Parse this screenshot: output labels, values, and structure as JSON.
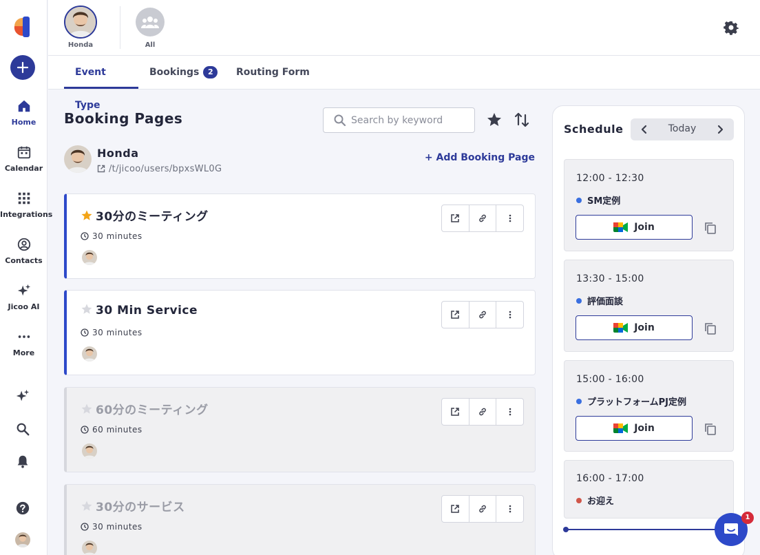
{
  "nav": {
    "items": [
      {
        "label": "Home",
        "icon": "home-icon"
      },
      {
        "label": "Calendar",
        "icon": "calendar-icon"
      },
      {
        "label": "Integrations",
        "icon": "apps-grid-icon"
      },
      {
        "label": "Contacts",
        "icon": "contact-icon"
      },
      {
        "label": "Jicoo AI",
        "icon": "sparkle-icon"
      },
      {
        "label": "More",
        "icon": "more-dots-icon"
      }
    ]
  },
  "accounts": [
    {
      "name": "Honda"
    },
    {
      "name": "All"
    }
  ],
  "tabs": [
    {
      "label": "Event Type"
    },
    {
      "label": "Bookings",
      "badge": "2"
    },
    {
      "label": "Routing Form"
    }
  ],
  "main": {
    "title": "Booking Pages",
    "search_placeholder": "Search by keyword",
    "user_name": "Honda",
    "user_path": "/t/jicoo/users/bpxsWL0G",
    "add_label": "+ Add Booking Page",
    "cards": [
      {
        "title": "30分のミーティング",
        "duration": "30 minutes",
        "starred": true,
        "disabled": false
      },
      {
        "title": "30 Min Service",
        "duration": "30 minutes",
        "starred": false,
        "disabled": false
      },
      {
        "title": "60分のミーティング",
        "duration": "60 minutes",
        "starred": false,
        "disabled": true
      },
      {
        "title": "30分のサービス",
        "duration": "30 minutes",
        "starred": false,
        "disabled": true
      }
    ]
  },
  "schedule": {
    "title": "Schedule",
    "today_label": "Today",
    "events": [
      {
        "time": "12:00 - 12:30",
        "name": "SM定例",
        "dot_color": "#3a6fe0",
        "join_label": "Join"
      },
      {
        "time": "13:30 - 15:00",
        "name": "評価面談",
        "dot_color": "#3a6fe0",
        "join_label": "Join"
      },
      {
        "time": "15:00 - 16:00",
        "name": "プラットフォームPJ定例",
        "dot_color": "#3a6fe0",
        "join_label": "Join"
      },
      {
        "time": "16:00 - 17:00",
        "name": "お迎え",
        "dot_color": "#d0564a"
      }
    ]
  },
  "chat": {
    "badge": "1"
  },
  "colors": {
    "accent": "#2d3a99",
    "card_border": "#2d49c9",
    "danger": "#d52b3a"
  }
}
